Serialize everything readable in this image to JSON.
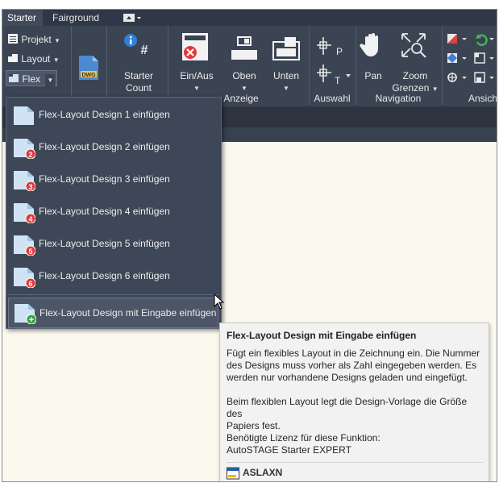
{
  "tabs": {
    "starter": "Starter",
    "fairground": "Fairground"
  },
  "ribbon": {
    "projekt": "Projekt",
    "layout": "Layout",
    "flex": "Flex",
    "dwg_badge": "DWG",
    "starter_count_1": "Starter",
    "starter_count_2": "Count",
    "einaus": "Ein/Aus",
    "oben": "Oben",
    "unten": "Unten",
    "pan": "Pan",
    "zoom_1": "Zoom",
    "zoom_2": "Grenzen",
    "groups": {
      "anzeige": "Anzeige",
      "auswahl": "Auswahl",
      "navigation": "Navigation",
      "ansicht": "Ansich"
    }
  },
  "menu": {
    "items": [
      {
        "label": "Flex-Layout Design 1 einfügen",
        "badge": ""
      },
      {
        "label": "Flex-Layout Design 2 einfügen",
        "badge": "2"
      },
      {
        "label": "Flex-Layout Design 3 einfügen",
        "badge": "3"
      },
      {
        "label": "Flex-Layout Design 4 einfügen",
        "badge": "4"
      },
      {
        "label": "Flex-Layout Design 5 einfügen",
        "badge": "5"
      },
      {
        "label": "Flex-Layout Design 6 einfügen",
        "badge": "6"
      }
    ],
    "last": {
      "label": "Flex-Layout Design mit Eingabe einfügen",
      "badge": "+"
    }
  },
  "tooltip": {
    "title": "Flex-Layout Design mit Eingabe einfügen",
    "p1_l1": "Fügt ein flexibles Layout in die Zeichnung ein. Die Nummer",
    "p1_l2": "des Designs muss vorher als Zahl eingegeben werden. Es",
    "p1_l3": "werden nur vorhandene Designs geladen und eingefügt.",
    "p2_l1": "Beim flexiblen Layout legt die Design-Vorlage die Größe des",
    "p2_l2": "Papiers fest.",
    "p3_l1": "Benötigte Lizenz für diese Funktion:",
    "p3_l2": "AutoSTAGE Starter EXPERT",
    "command": "ASLAXN"
  },
  "colors": {
    "ribbon_bg": "#3b4453",
    "tab_bar": "#2f3847",
    "menu_bg": "#3e4757",
    "canvas": "#fbf8ee",
    "badge_red": "#e03a3a",
    "badge_green": "#3aa14a"
  }
}
